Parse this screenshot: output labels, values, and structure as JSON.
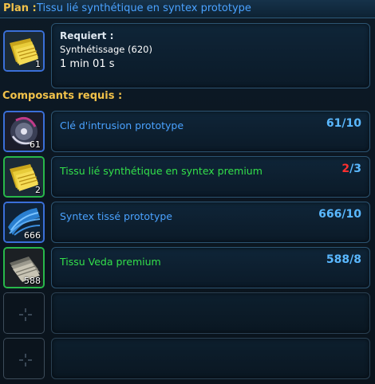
{
  "plan": {
    "label": "Plan :",
    "name": "Tissu lié synthétique en syntex prototype",
    "item_count": "1",
    "item_icon": "yellow-fabric-icon"
  },
  "requirements": {
    "label": "Requiert :",
    "skill": "Synthétissage (620)",
    "time": "1 min 01 s"
  },
  "components_label": "Composants requis :",
  "components": [
    {
      "name": "Clé d'intrusion prototype",
      "have": "61",
      "need": "/10",
      "count": "61",
      "name_color": "blue",
      "frame": "blue",
      "icon": "intrusion-key-icon"
    },
    {
      "name": "Tissu lié synthétique en syntex premium",
      "have": "2",
      "need": "/3",
      "count": "2",
      "name_color": "green",
      "frame": "green",
      "icon": "yellow-fabric-icon",
      "insufficient": true
    },
    {
      "name": "Syntex tissé prototype",
      "have": "666",
      "need": "/10",
      "count": "666",
      "name_color": "blue",
      "frame": "blue",
      "icon": "blue-syntex-icon"
    },
    {
      "name": "Tissu Veda premium",
      "have": "588",
      "need": "/8",
      "count": "588",
      "name_color": "green",
      "frame": "green",
      "icon": "grey-fabric-icon"
    }
  ],
  "colors": {
    "gold_label": "#f2c24a",
    "blue_name": "#4aa2ff",
    "green_name": "#33e04a",
    "qty_blue": "#5ab8ff",
    "qty_red": "#ff2f2f"
  }
}
